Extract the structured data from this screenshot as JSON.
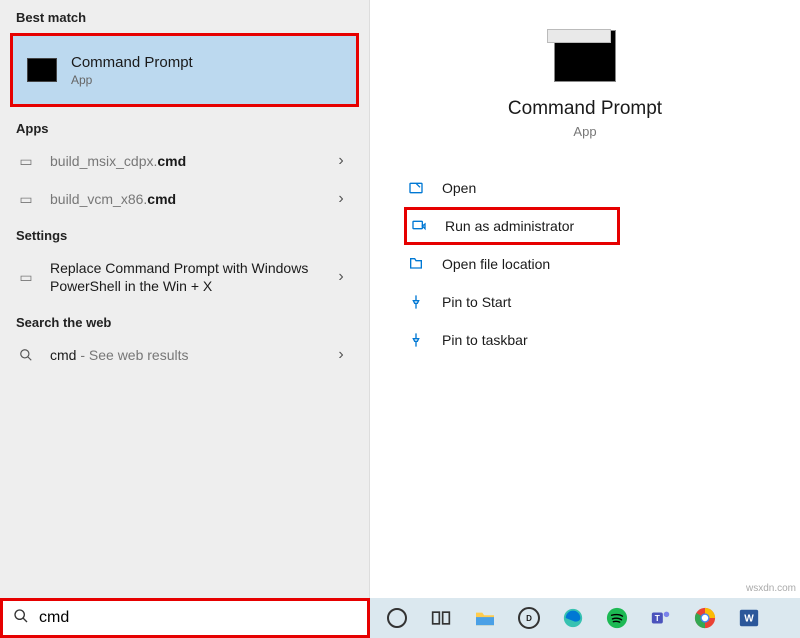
{
  "sections": {
    "best_match": "Best match",
    "apps": "Apps",
    "settings": "Settings",
    "web": "Search the web"
  },
  "best_match_item": {
    "title": "Command Prompt",
    "subtitle": "App"
  },
  "apps_items": [
    {
      "text_plain": "build_msix_cdpx.",
      "text_bold": "cmd"
    },
    {
      "text_plain": "build_vcm_x86.",
      "text_bold": "cmd"
    }
  ],
  "settings_item": {
    "label": "Replace Command Prompt with Windows PowerShell in the Win + X"
  },
  "web_item": {
    "query": "cmd",
    "hint": " - See web results"
  },
  "preview": {
    "title": "Command Prompt",
    "subtitle": "App"
  },
  "actions": {
    "open": "Open",
    "run_admin": "Run as administrator",
    "file_loc": "Open file location",
    "pin_start": "Pin to Start",
    "pin_taskbar": "Pin to taskbar"
  },
  "search": {
    "value": "cmd"
  },
  "watermark": "wsxdn.com"
}
